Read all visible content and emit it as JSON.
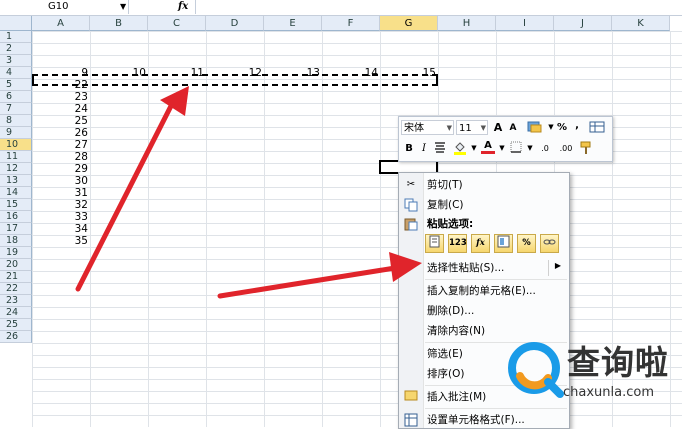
{
  "formula_bar": {
    "name_box": "G10",
    "fx": "fx"
  },
  "columns": [
    "A",
    "B",
    "C",
    "D",
    "E",
    "F",
    "G",
    "H",
    "I",
    "J",
    "K"
  ],
  "selected_column": "G",
  "rows": [
    "1",
    "2",
    "3",
    "4",
    "5",
    "6",
    "7",
    "8",
    "9",
    "10",
    "11",
    "12",
    "13",
    "14",
    "15",
    "16",
    "17",
    "18",
    "19",
    "20",
    "21",
    "22",
    "23",
    "24",
    "25",
    "26"
  ],
  "selected_row": "10",
  "row4_values": [
    "9",
    "10",
    "11",
    "12",
    "13",
    "14",
    "15"
  ],
  "col_a_values": [
    "22",
    "23",
    "24",
    "25",
    "26",
    "27",
    "28",
    "29",
    "30",
    "31",
    "32",
    "33",
    "34",
    "35"
  ],
  "mini_toolbar": {
    "font_name": "宋体",
    "font_size": "11",
    "grow_font": "A",
    "shrink_font": "A",
    "percent": "%",
    "comma": ",",
    "bold": "B",
    "italic": "I",
    "font_color": "A",
    "increase_decimal": ".0",
    "decrease_decimal": ".00"
  },
  "context_menu": {
    "cut": "剪切(T)",
    "copy": "复制(C)",
    "paste_options": "粘贴选项:",
    "paste_icons": [
      "",
      "123",
      "fx",
      "",
      "%",
      ""
    ],
    "paste_special": "选择性粘贴(S)...",
    "insert_copied": "插入复制的单元格(E)...",
    "delete": "删除(D)...",
    "clear": "清除内容(N)",
    "filter": "筛选(E)",
    "sort": "排序(O)",
    "insert_comment": "插入批注(M)",
    "format_cells": "设置单元格格式(F)..."
  },
  "watermark": {
    "text": "查询啦",
    "url": "chaxunla.com"
  },
  "colors": {
    "header_bg": "#e4ecf7",
    "header_sel": "#f8e08a",
    "arrow": "#e0242b",
    "logo_blue": "#1a9be8",
    "logo_orange": "#f29a1f"
  }
}
